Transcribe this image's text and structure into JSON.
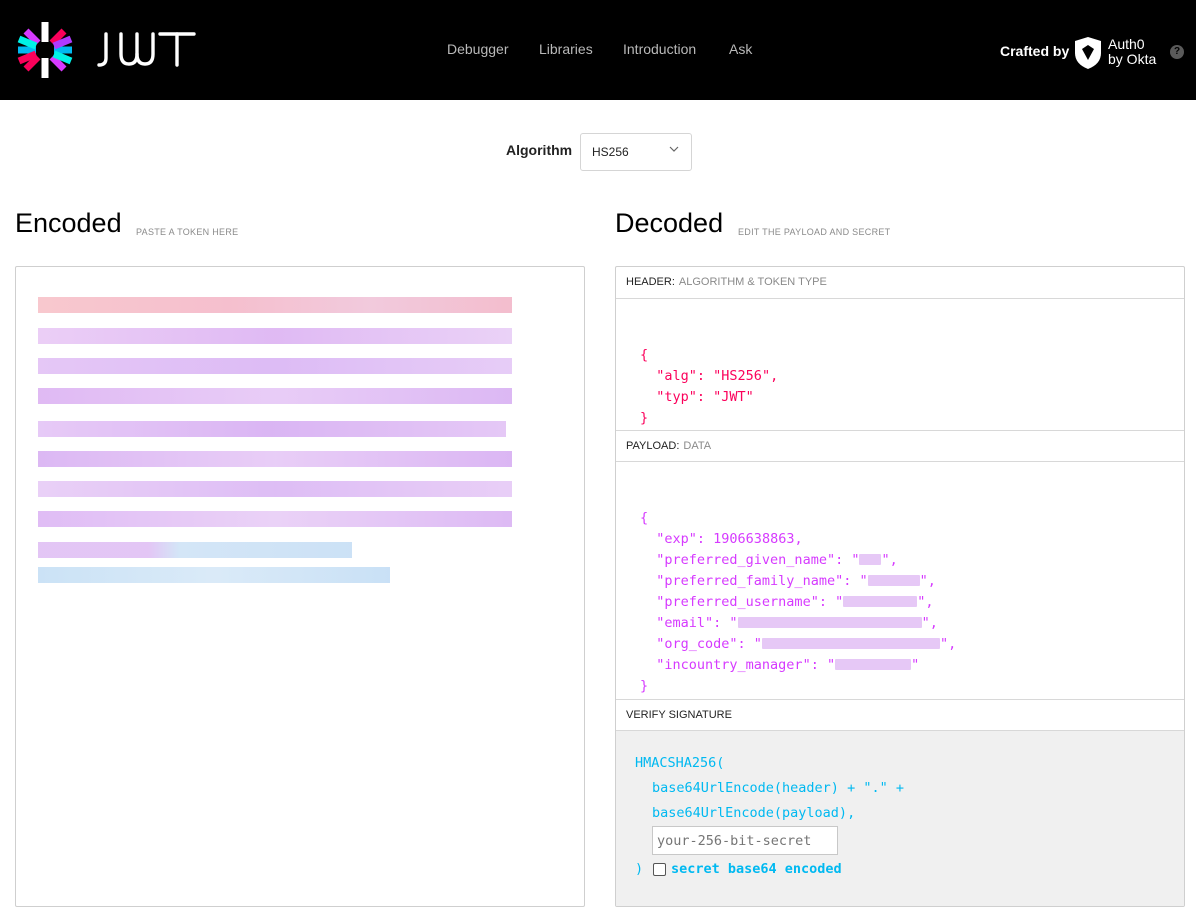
{
  "nav": {
    "brand": "JWT",
    "links": [
      "Debugger",
      "Libraries",
      "Introduction",
      "Ask"
    ],
    "crafted_by": "Crafted by",
    "auth0_line1": "Auth0",
    "auth0_line2": "by Okta",
    "help": "?"
  },
  "algorithm": {
    "label": "Algorithm",
    "selected": "HS256"
  },
  "encoded": {
    "title": "Encoded",
    "hint": "PASTE A TOKEN HERE"
  },
  "decoded": {
    "title": "Decoded",
    "hint": "EDIT THE PAYLOAD AND SECRET",
    "header_section": {
      "label": "HEADER:",
      "muted": "ALGORITHM & TOKEN TYPE",
      "open": "{",
      "alg_key": "\"alg\"",
      "alg_val": "\"HS256\"",
      "typ_key": "\"typ\"",
      "typ_val": "\"JWT\"",
      "close": "}"
    },
    "payload_section": {
      "label": "PAYLOAD:",
      "muted": "DATA",
      "open": "{",
      "exp_key": "\"exp\"",
      "exp_val": "1906638863",
      "k_given": "\"preferred_given_name\"",
      "k_family": "\"preferred_family_name\"",
      "k_username": "\"preferred_username\"",
      "k_email": "\"email\"",
      "k_org": "\"org_code\"",
      "k_manager": "\"incountry_manager\"",
      "close": "}"
    },
    "verify_section": {
      "label": "VERIFY SIGNATURE",
      "fn": "HMACSHA256(",
      "line1": "base64UrlEncode(header) + \".\" +",
      "line2": "base64UrlEncode(payload),",
      "secret_placeholder": "your-256-bit-secret",
      "close": ")",
      "checkbox_label": "secret base64 encoded"
    }
  },
  "colors": {
    "header_json": "#fb015b",
    "payload_json": "#d63aff",
    "signature": "#00b9f1"
  }
}
